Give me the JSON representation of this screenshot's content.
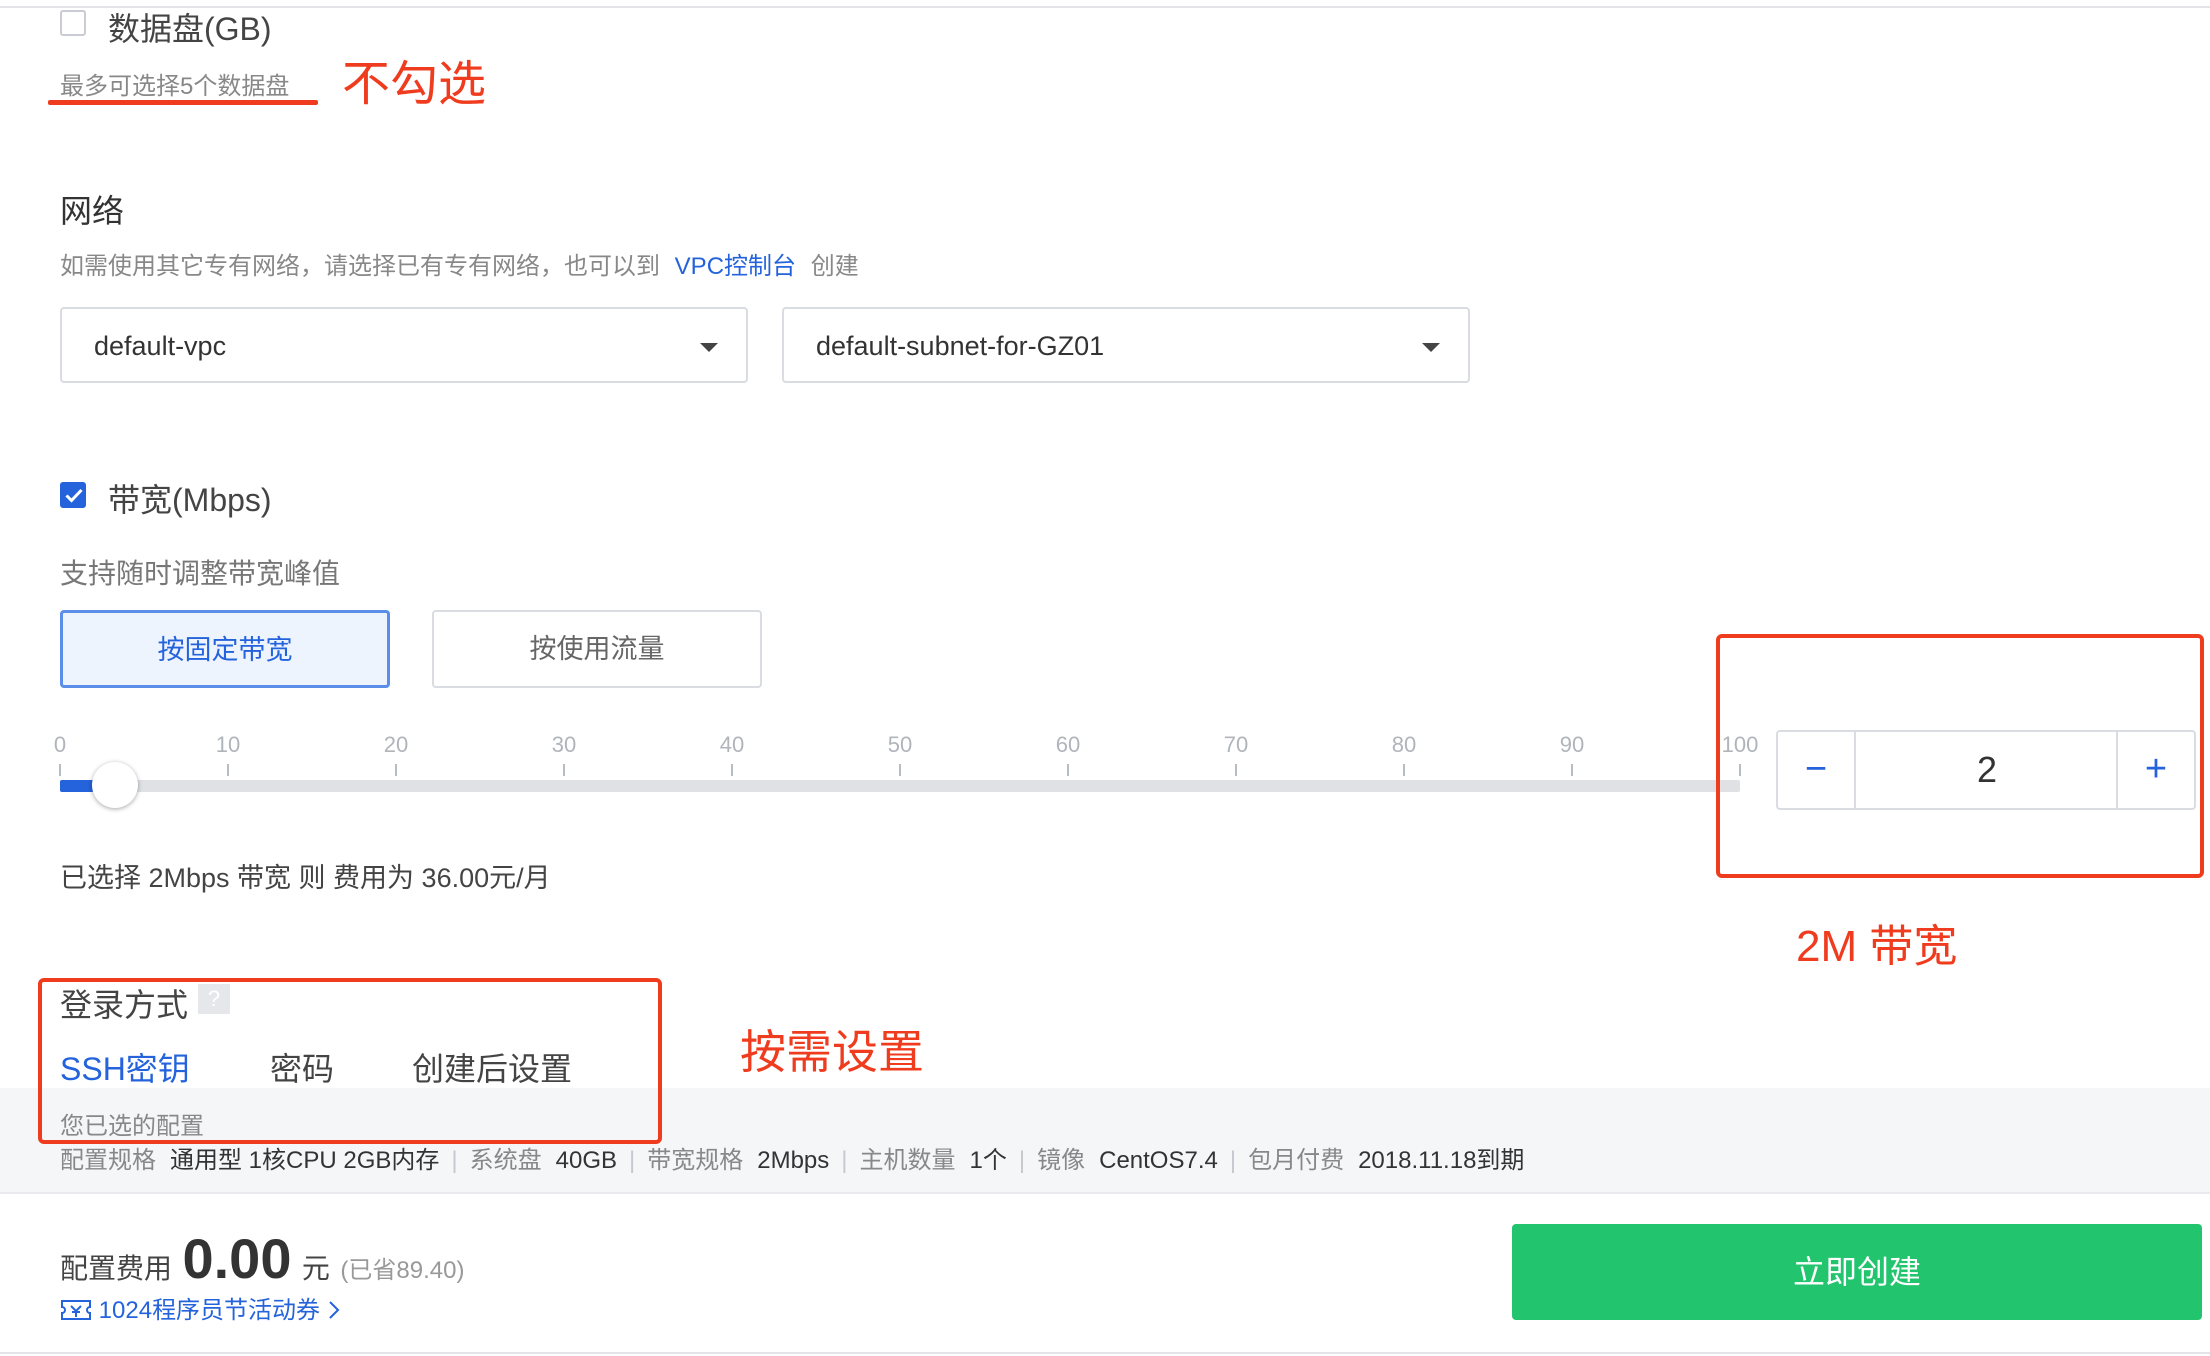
{
  "data_disk": {
    "label": "数据盘(GB)",
    "hint": "最多可选择5个数据盘",
    "annotation": "不勾选",
    "checked": false
  },
  "network": {
    "title": "网络",
    "hint_prefix": "如需使用其它专有网络，请选择已有专有网络，也可以到",
    "hint_link": "VPC控制台",
    "hint_suffix": "创建",
    "vpc_value": "default-vpc",
    "subnet_value": "default-subnet-for-GZ01"
  },
  "bandwidth": {
    "label": "带宽(Mbps)",
    "checked": true,
    "hint": "支持随时调整带宽峰值",
    "options": [
      "按固定带宽",
      "按使用流量"
    ],
    "selected_option": "按固定带宽",
    "slider_ticks": [
      "0",
      "10",
      "20",
      "30",
      "40",
      "50",
      "60",
      "70",
      "80",
      "90",
      "100"
    ],
    "slider_value": 2,
    "slider_max": 100,
    "stepper_value": "2",
    "stepper_minus": "−",
    "stepper_plus": "+",
    "summary": "已选择 2Mbps 带宽 则 费用为 36.00元/月",
    "annotation": "2M 带宽"
  },
  "login": {
    "title": "登录方式",
    "help_icon": "?",
    "tabs": [
      "SSH密钥",
      "密码",
      "创建后设置"
    ],
    "active_tab": "SSH密钥",
    "annotation": "按需设置"
  },
  "selected_config": {
    "title": "您已选的配置",
    "items": [
      {
        "label": "配置规格",
        "value": "通用型 1核CPU 2GB内存"
      },
      {
        "label": "系统盘",
        "value": "40GB"
      },
      {
        "label": "带宽规格",
        "value": "2Mbps"
      },
      {
        "label": "主机数量",
        "value": "1个"
      },
      {
        "label": "镜像",
        "value": "CentOS7.4"
      },
      {
        "label": "包月付费",
        "value": "2018.11.18到期"
      }
    ]
  },
  "footer": {
    "fee_label": "配置费用",
    "fee_amount": "0.00",
    "fee_unit": "元",
    "fee_saved": "(已省89.40)",
    "coupon_text": "1024程序员节活动券",
    "create_button": "立即创建"
  },
  "colors": {
    "accent_blue": "#2463db",
    "annotation_red": "#f03c1e",
    "create_green": "#22c56e"
  }
}
